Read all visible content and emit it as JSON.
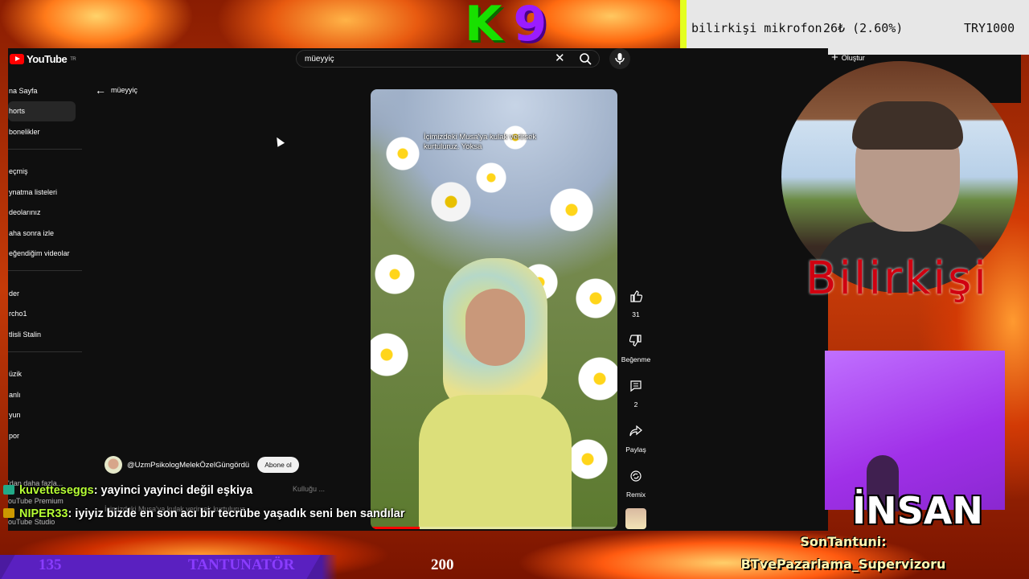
{
  "youtube": {
    "logo_text": "YouTube",
    "logo_region": "TR",
    "search_value": "müeyyiç",
    "create_label": "Oluştur",
    "back_label": "müeyyiç",
    "sidebar": [
      {
        "label": "na Sayfa"
      },
      {
        "label": "horts",
        "active": true
      },
      {
        "label": "bonelikler"
      },
      {
        "gap": true
      },
      {
        "label": "eçmiş"
      },
      {
        "label": "ynatma listeleri"
      },
      {
        "label": "deolarınız"
      },
      {
        "label": "aha sonra izle"
      },
      {
        "label": "eğendiğim videolar"
      },
      {
        "gap": true
      },
      {
        "label": "der"
      },
      {
        "label": "rcho1"
      },
      {
        "label": "tlisli Stalin"
      },
      {
        "gap": true
      },
      {
        "label": "üzik"
      },
      {
        "label": "anlı"
      },
      {
        "label": "yun"
      },
      {
        "label": "por"
      }
    ],
    "sidebar_more": "'dan daha fazla...",
    "sidebar_premium": "ouTube Premium",
    "sidebar_studio": "ouTube Studio",
    "short": {
      "caption": "İçimizdeki Musa'ya kulak verirsek kurtuluruz. Yoksa",
      "channel": "@UzmPsikologMelekÖzelGüngördü",
      "subscribe_label": "Abone ol",
      "title_ghost": "Kulluğu ...",
      "desc_ghost": "İçimizdeki Musa'ya kulak verirsek kurtuluruz",
      "progress": 0.2,
      "actions": {
        "likes": "31",
        "dislike_label": "Beğenme",
        "comments": "2",
        "share_label": "Paylaş",
        "remix_label": "Remix"
      }
    }
  },
  "chat": [
    {
      "user": "kuvetteseggs",
      "message": ": yayinci yayinci değil eşkiya"
    },
    {
      "user": "NIPER33",
      "message": ": iyiyiz bizde en son acı bir tecrübe yaşadık seni ben sandılar"
    }
  ],
  "ticker": {
    "item": "bilirkişi mikrofon",
    "price": "26₺ (2.60%)",
    "goal": "TRY1000"
  },
  "k9": {
    "k": "K",
    "n": "9"
  },
  "webcam": {
    "label": "Bilirkişi"
  },
  "insan_label": "İNSAN",
  "son_tantuni": {
    "title": "SonTantuni:",
    "name": "BTvePazarlama_Supervizoru"
  },
  "bottom_bar": {
    "left": "135",
    "middle": "TANTUNATÖR",
    "right": "200"
  },
  "colors": {
    "chat_user": "#b6ff34",
    "youtube_red": "#ff0000",
    "ticker_accent": "#e4ff20",
    "bilirkisi_red": "#d00010",
    "purple": "#a030e8"
  }
}
